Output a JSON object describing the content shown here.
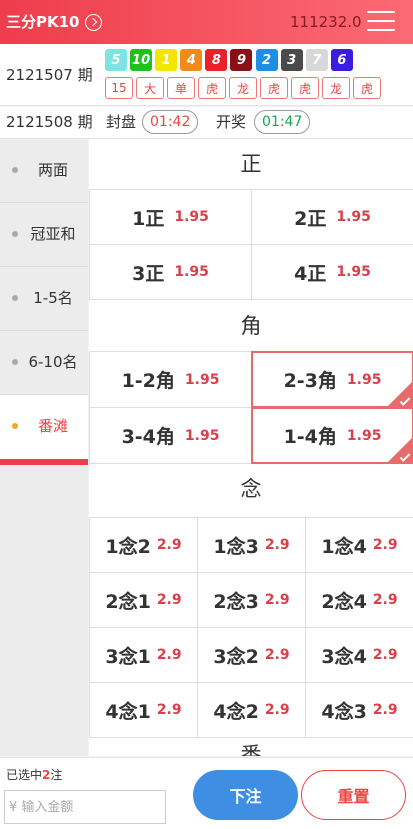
{
  "header": {
    "title": "三分PK10",
    "balance": "111232.0"
  },
  "last_result": {
    "issue": "2121507 期",
    "balls": [
      {
        "num": "5",
        "color": "#7de3e3"
      },
      {
        "num": "10",
        "color": "#1ec21e"
      },
      {
        "num": "1",
        "color": "#f2e600"
      },
      {
        "num": "4",
        "color": "#f08a19"
      },
      {
        "num": "8",
        "color": "#e8212a"
      },
      {
        "num": "9",
        "color": "#8a0f16"
      },
      {
        "num": "2",
        "color": "#1b8fe3"
      },
      {
        "num": "3",
        "color": "#4a4a4a"
      },
      {
        "num": "7",
        "color": "#d8d8d8"
      },
      {
        "num": "6",
        "color": "#3a1de0"
      }
    ],
    "tags": [
      "15",
      "大",
      "单",
      "虎",
      "龙",
      "虎",
      "虎",
      "龙",
      "虎"
    ]
  },
  "current": {
    "issue": "2121508 期",
    "lock_label": "封盘",
    "lock_time": "01:42",
    "draw_label": "开奖",
    "draw_time": "01:47"
  },
  "sidebar": {
    "items": [
      {
        "label": "两面",
        "active": false
      },
      {
        "label": "冠亚和",
        "active": false
      },
      {
        "label": "1-5名",
        "active": false
      },
      {
        "label": "6-10名",
        "active": false
      },
      {
        "label": "番滩",
        "active": true
      }
    ]
  },
  "sections": {
    "zheng": {
      "title": "正",
      "options": [
        {
          "name": "1正",
          "odds": "1.95",
          "selected": false
        },
        {
          "name": "2正",
          "odds": "1.95",
          "selected": false
        },
        {
          "name": "3正",
          "odds": "1.95",
          "selected": false
        },
        {
          "name": "4正",
          "odds": "1.95",
          "selected": false
        }
      ]
    },
    "jiao": {
      "title": "角",
      "options": [
        {
          "name": "1-2角",
          "odds": "1.95",
          "selected": false
        },
        {
          "name": "2-3角",
          "odds": "1.95",
          "selected": true
        },
        {
          "name": "3-4角",
          "odds": "1.95",
          "selected": false
        },
        {
          "name": "1-4角",
          "odds": "1.95",
          "selected": true
        }
      ]
    },
    "nian": {
      "title": "念",
      "options": [
        {
          "name": "1念2",
          "odds": "2.9",
          "selected": false
        },
        {
          "name": "1念3",
          "odds": "2.9",
          "selected": false
        },
        {
          "name": "1念4",
          "odds": "2.9",
          "selected": false
        },
        {
          "name": "2念1",
          "odds": "2.9",
          "selected": false
        },
        {
          "name": "2念3",
          "odds": "2.9",
          "selected": false
        },
        {
          "name": "2念4",
          "odds": "2.9",
          "selected": false
        },
        {
          "name": "3念1",
          "odds": "2.9",
          "selected": false
        },
        {
          "name": "3念2",
          "odds": "2.9",
          "selected": false
        },
        {
          "name": "3念4",
          "odds": "2.9",
          "selected": false
        },
        {
          "name": "4念1",
          "odds": "2.9",
          "selected": false
        },
        {
          "name": "4念2",
          "odds": "2.9",
          "selected": false
        },
        {
          "name": "4念3",
          "odds": "2.9",
          "selected": false
        }
      ]
    },
    "next": {
      "title": "番"
    }
  },
  "footer": {
    "selected_prefix": "已选中",
    "selected_count": "2",
    "selected_suffix": "注",
    "amount_placeholder": "¥ 输入金额",
    "bet_label": "下注",
    "reset_label": "重置"
  },
  "icons": {
    "title_arrow": "chevron-right-circle-icon",
    "menu": "hamburger-menu-icon",
    "check": "check-icon"
  }
}
